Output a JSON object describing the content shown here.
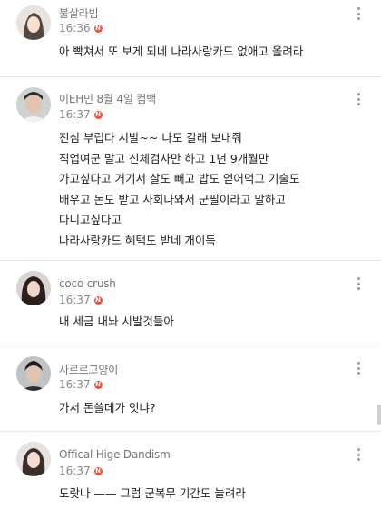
{
  "comments": [
    {
      "author": "불살라빔",
      "time": "16:36",
      "lines": [
        "아 빡쳐서 또 보게 되네 나라사랑카드 없애고 올려라"
      ]
    },
    {
      "author": "이EH민 8월 4일 컴백",
      "time": "16:37",
      "lines": [
        "진심 부럽다 시발~~ 나도 갈래 보내줘",
        "직업여군 말고 신체검사만 하고 1년 9개월만",
        "가고싶다고 거기서 살도 빼고 밥도 얻어먹고 기술도",
        "배우고 돈도 받고 사회나와서 군필이라고 말하고",
        "다니고싶다고",
        "나라사랑카드 혜택도 받네 개이득"
      ]
    },
    {
      "author": "coco crush",
      "time": "16:37",
      "lines": [
        "내 세금 내놔 시발것들아"
      ]
    },
    {
      "author": "사르르고양이",
      "time": "16:37",
      "lines": [
        "가서 돈쓸데가 잇냐?"
      ]
    },
    {
      "author": "Offical Hige Dandism",
      "time": "16:37",
      "lines": [
        "도랏나 —— 그럼 군복무 기간도 늘려라"
      ]
    }
  ],
  "badge_label": "N",
  "colors": {
    "badge": "#f0503c",
    "divider": "#e9e9e9",
    "author": "#777777"
  }
}
